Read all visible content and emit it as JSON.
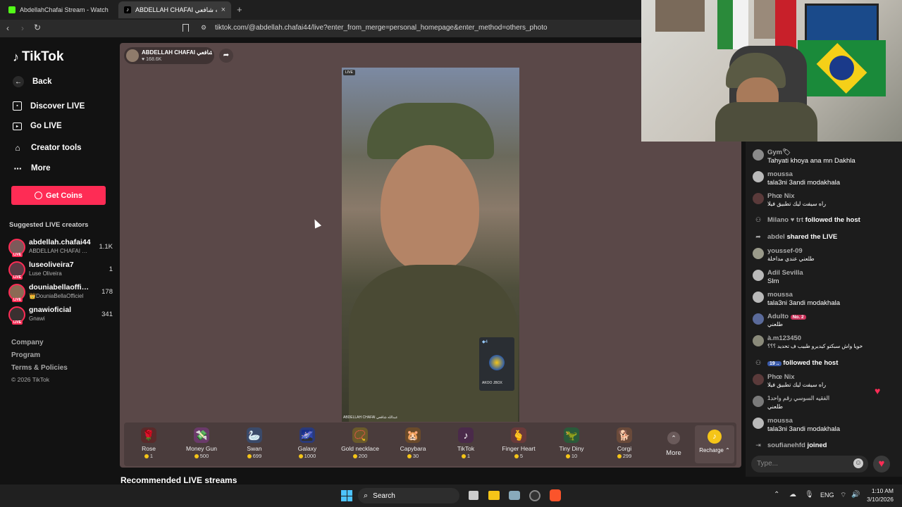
{
  "browser": {
    "tabs": [
      {
        "title": "AbdellahChafai Stream - Watch Live on Kick",
        "favicon_color": "#53fc18"
      },
      {
        "title": "ABDELLAH CHAFAI عبدالله شافعي",
        "favicon_color": "#ffffff"
      }
    ],
    "new_tab": "+",
    "close": "×",
    "url": "tiktok.com/@abdellah.chafai44/live?enter_from_merge=personal_homepage&enter_method=others_photo"
  },
  "sidebar": {
    "logo": "TikTok",
    "nav": [
      {
        "label": "Back",
        "icon": "back-arrow-icon"
      },
      {
        "label": "Discover LIVE",
        "icon": "calendar-icon"
      },
      {
        "label": "Go LIVE",
        "icon": "video-camera-icon"
      },
      {
        "label": "Creator tools",
        "icon": "lightbulb-icon"
      },
      {
        "label": "More",
        "icon": "more-dots-icon"
      }
    ],
    "get_coins": "Get Coins",
    "suggested_title": "Suggested LIVE creators",
    "live_badge": "LIVE",
    "creators": [
      {
        "name": "abdellah.chafai44",
        "sub": "ABDELLAH CHAFAI عبدالله شافعي",
        "count": "1.1K"
      },
      {
        "name": "luseoliveira7",
        "sub": "Luse Oliveira",
        "count": "1"
      },
      {
        "name": "douniabellaofficiel",
        "sub": "👑DouniaBellaOfficiel",
        "count": "178"
      },
      {
        "name": "gnawioficial",
        "sub": "Gnawi",
        "count": "341"
      }
    ],
    "footer": [
      "Company",
      "Program",
      "Terms & Policies",
      "© 2026 TikTok"
    ]
  },
  "host": {
    "name": "ABDELLAH CHAFAI عبدالله شافعي",
    "likes": "168.6K"
  },
  "video": {
    "live_label": "LIVE",
    "overlay_name": "ABDELLAH CHAFAI عبدالله شافعي",
    "pip_count": "4",
    "pip_caption": "AKOO JBOX"
  },
  "gifts": [
    {
      "name": "Rose",
      "price": "1",
      "icon": "🌹"
    },
    {
      "name": "Money Gun",
      "price": "500",
      "icon": "💸"
    },
    {
      "name": "Swan",
      "price": "699",
      "icon": "🦢"
    },
    {
      "name": "Galaxy",
      "price": "1000",
      "icon": "🌌"
    },
    {
      "name": "Gold necklace",
      "price": "200",
      "icon": "📿"
    },
    {
      "name": "Capybara",
      "price": "30",
      "icon": "🐹"
    },
    {
      "name": "TikTok",
      "price": "1",
      "icon": "♪"
    },
    {
      "name": "Finger Heart",
      "price": "5",
      "icon": "🫰"
    },
    {
      "name": "Tiny Diny",
      "price": "10",
      "icon": "🦖"
    },
    {
      "name": "Corgi",
      "price": "299",
      "icon": "🐕"
    }
  ],
  "gift_more": "More",
  "recharge": "Recharge",
  "recommended_title": "Recommended LIVE streams",
  "chat": {
    "messages": [
      {
        "user": "Gym🏷",
        "text": "Tahyati khoya ana mn Dakhla"
      },
      {
        "user": "moussa",
        "text": "tala3ni 3andi modakhala"
      },
      {
        "user": "Phœ Nix",
        "text": "راه سيفت ليك تطبيق فيلا"
      },
      {
        "user": "Milano ♥ trt",
        "text": "followed the host",
        "action": true
      },
      {
        "user": "abdel",
        "text": "shared the LIVE",
        "action": true
      },
      {
        "user": "youssef-09",
        "text": "طلعني عندي مداخلة"
      },
      {
        "user": "Adil Sevilla",
        "text": "Slm"
      },
      {
        "user": "moussa",
        "text": "tala3ni 3andi modakhala"
      },
      {
        "user": "Adulto",
        "badge": "No. 2",
        "text": "طلعني"
      },
      {
        "user": "à.m123450",
        "text": "خويا واش سبكتو كيديرو طبيب ف تحديد ؟؟؟"
      },
      {
        "user": "19 ..",
        "text": "followed the host",
        "action": true
      },
      {
        "user": "Phœ Nix",
        "text": "راه سيفت ليك تطبيق فيلا"
      },
      {
        "user": "الفقيه السوسي رقم واحد1",
        "text": "طلعني"
      },
      {
        "user": "moussa",
        "text": "tala3ni 3andi modakhala"
      },
      {
        "user": "soufianehfd",
        "text": "joined",
        "action": true
      }
    ],
    "input_placeholder": "Type...",
    "heart_icon": "heart-icon"
  },
  "taskbar": {
    "search": "Search",
    "lang": "ENG",
    "time": "1:10 AM",
    "date": "3/10/2026"
  }
}
